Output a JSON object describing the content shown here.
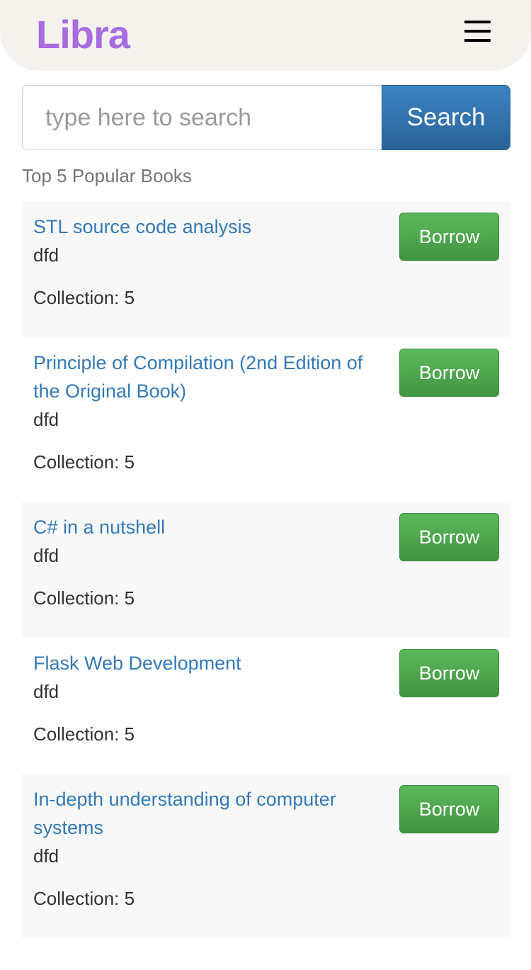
{
  "header": {
    "logo": "Libra",
    "menu_icon": "hamburger-menu-icon"
  },
  "search": {
    "placeholder": "type here to search",
    "value": "",
    "button_label": "Search"
  },
  "colors": {
    "logo": "#a86ce0",
    "header_bg": "#f5f2ed",
    "link": "#337ab7",
    "primary_button": "#2a639a",
    "success_button": "#5cb85c"
  },
  "section_title": "Top 5 Popular Books",
  "books": [
    {
      "title": "STL source code analysis",
      "author": "dfd",
      "collection": "Collection: 5",
      "button_label": "Borrow"
    },
    {
      "title": "Principle of Compilation (2nd Edition of the Original Book)",
      "author": "dfd",
      "collection": "Collection: 5",
      "button_label": "Borrow"
    },
    {
      "title": "C# in a nutshell",
      "author": "dfd",
      "collection": "Collection: 5",
      "button_label": "Borrow"
    },
    {
      "title": "Flask Web Development",
      "author": "dfd",
      "collection": "Collection: 5",
      "button_label": "Borrow"
    },
    {
      "title": "In-depth understanding of computer systems",
      "author": "dfd",
      "collection": "Collection: 5",
      "button_label": "Borrow"
    }
  ]
}
